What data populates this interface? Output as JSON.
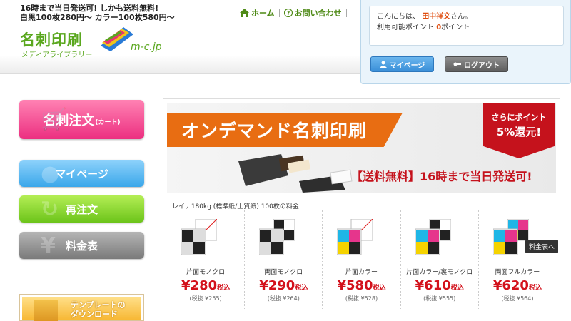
{
  "header": {
    "tagline": [
      "16時まで当日発送可! しかも送料無料!",
      "白黒100枚280円〜 カラー100枚580円〜"
    ],
    "logo_main": "名刺印刷",
    "logo_sub": "メディアライブラリー",
    "logo_domain": "m-c.jp",
    "nav": {
      "home": "ホーム",
      "contact": "お問い合わせ"
    }
  },
  "user": {
    "greeting_prefix": "こんにちは、",
    "name": "田中祥文",
    "greeting_suffix": "さん。",
    "points_label": "利用可能ポイント",
    "points_value": "0",
    "points_unit": "ポイント",
    "mypage_button": "マイページ",
    "logout_button": "ログアウト"
  },
  "sidebar": {
    "order": "名刺注文",
    "order_small": "(カート)",
    "mypage": "マイページ",
    "reorder": "再注文",
    "price_table": "料金表",
    "template": [
      "テンプレートの",
      "ダウンロード"
    ]
  },
  "banner": {
    "title": "オンデマンド名刺印刷",
    "badge_line1": "さらにポイント",
    "badge_line2": "5%還元!",
    "subtitle": "【送料無料】16時まで当日発送可!"
  },
  "paper_label": "レイナ180kg (標準紙/上質紙) 100枚の料金",
  "products": [
    {
      "name": "片面モノクロ",
      "price": "¥280",
      "tax": "税込",
      "pretax": "(税抜 ¥255)"
    },
    {
      "name": "両面モノクロ",
      "price": "¥290",
      "tax": "税込",
      "pretax": "(税抜 ¥264)"
    },
    {
      "name": "片面カラー",
      "price": "¥580",
      "tax": "税込",
      "pretax": "(税抜 ¥528)"
    },
    {
      "name": "片面カラー/裏モノクロ",
      "price": "¥610",
      "tax": "税込",
      "pretax": "(税抜 ¥555)"
    },
    {
      "name": "両面フルカラー",
      "price": "¥620",
      "tax": "税込",
      "pretax": "(税抜 ¥564)"
    }
  ],
  "tooltip": "料金表へ"
}
